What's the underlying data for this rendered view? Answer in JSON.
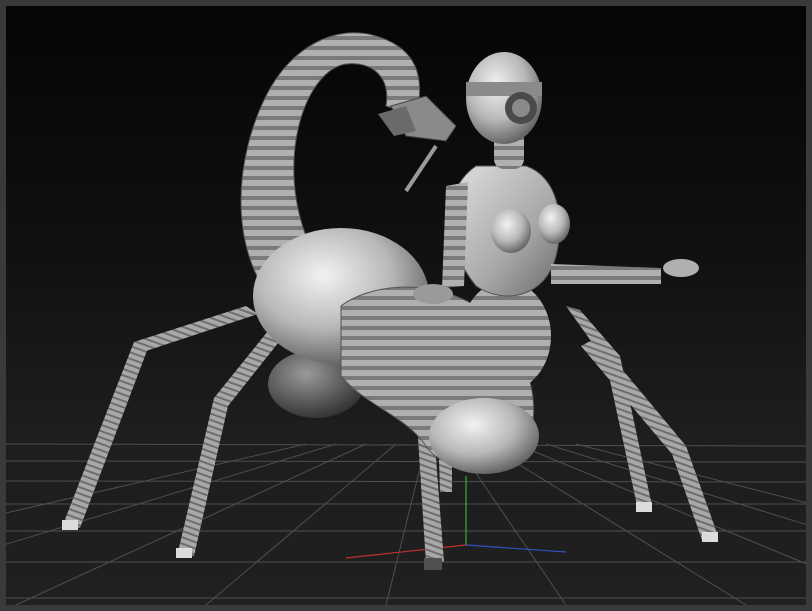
{
  "viewport": {
    "colors": {
      "frame": "#3a3a3a",
      "background_top": "#050505",
      "background_bottom": "#2a2a2a",
      "grid": "#5a5a5a",
      "axis_x": "#c03030",
      "axis_y": "#30b040",
      "axis_z": "#3050c0",
      "mesh_light": "#d2d2d2",
      "mesh_mid": "#9a9a9a",
      "mesh_dark": "#4a4a4a"
    },
    "model_icon": "scorpion-centaur-mesh-icon",
    "grid_icon": "floor-grid-icon",
    "gizmo_icon": "axis-gizmo-icon"
  }
}
